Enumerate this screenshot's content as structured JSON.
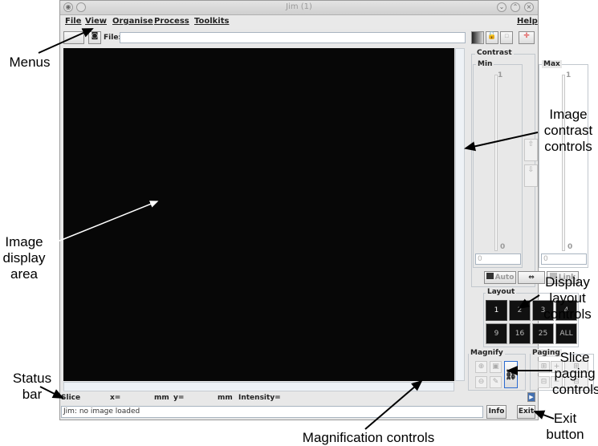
{
  "window": {
    "title": "Jim (1)"
  },
  "menus": [
    {
      "label": "File"
    },
    {
      "label": "View"
    },
    {
      "label": "Organise"
    },
    {
      "label": "Process"
    },
    {
      "label": "Toolkits"
    }
  ],
  "help_menu": "Help",
  "toolbar": {
    "file_label": "File:",
    "file_value": ""
  },
  "contrast": {
    "group_label": "Contrast",
    "min_label": "Min",
    "max_label": "Max",
    "min_top": "1",
    "min_bottom": "0",
    "max_top": "1",
    "max_bottom": "0",
    "min_value": "0",
    "max_value": "0",
    "auto_label": "Auto",
    "link_label": "Link"
  },
  "layout": {
    "group_label": "Layout",
    "buttons": [
      "1",
      "2",
      "3",
      "4",
      "9",
      "16",
      "25",
      "ALL"
    ]
  },
  "magnify": {
    "group_label": "Magnify"
  },
  "paging": {
    "group_label": "Paging"
  },
  "status_bar": {
    "slice_label": "Slice",
    "x_label": "x=",
    "mm1": "mm",
    "y_label": "y=",
    "mm2": "mm",
    "intensity_label": "Intensity=",
    "message": "Jim: no image loaded",
    "info_label": "Info",
    "exit_label": "Exit"
  },
  "annotations": {
    "menus": "Menus",
    "image_display": "Image display area",
    "contrast": "Image contrast controls",
    "layout": "Display layout controls",
    "paging": "Slice paging controls",
    "status": "Status bar",
    "magnification": "Magnification controls",
    "exit": "Exit button"
  }
}
